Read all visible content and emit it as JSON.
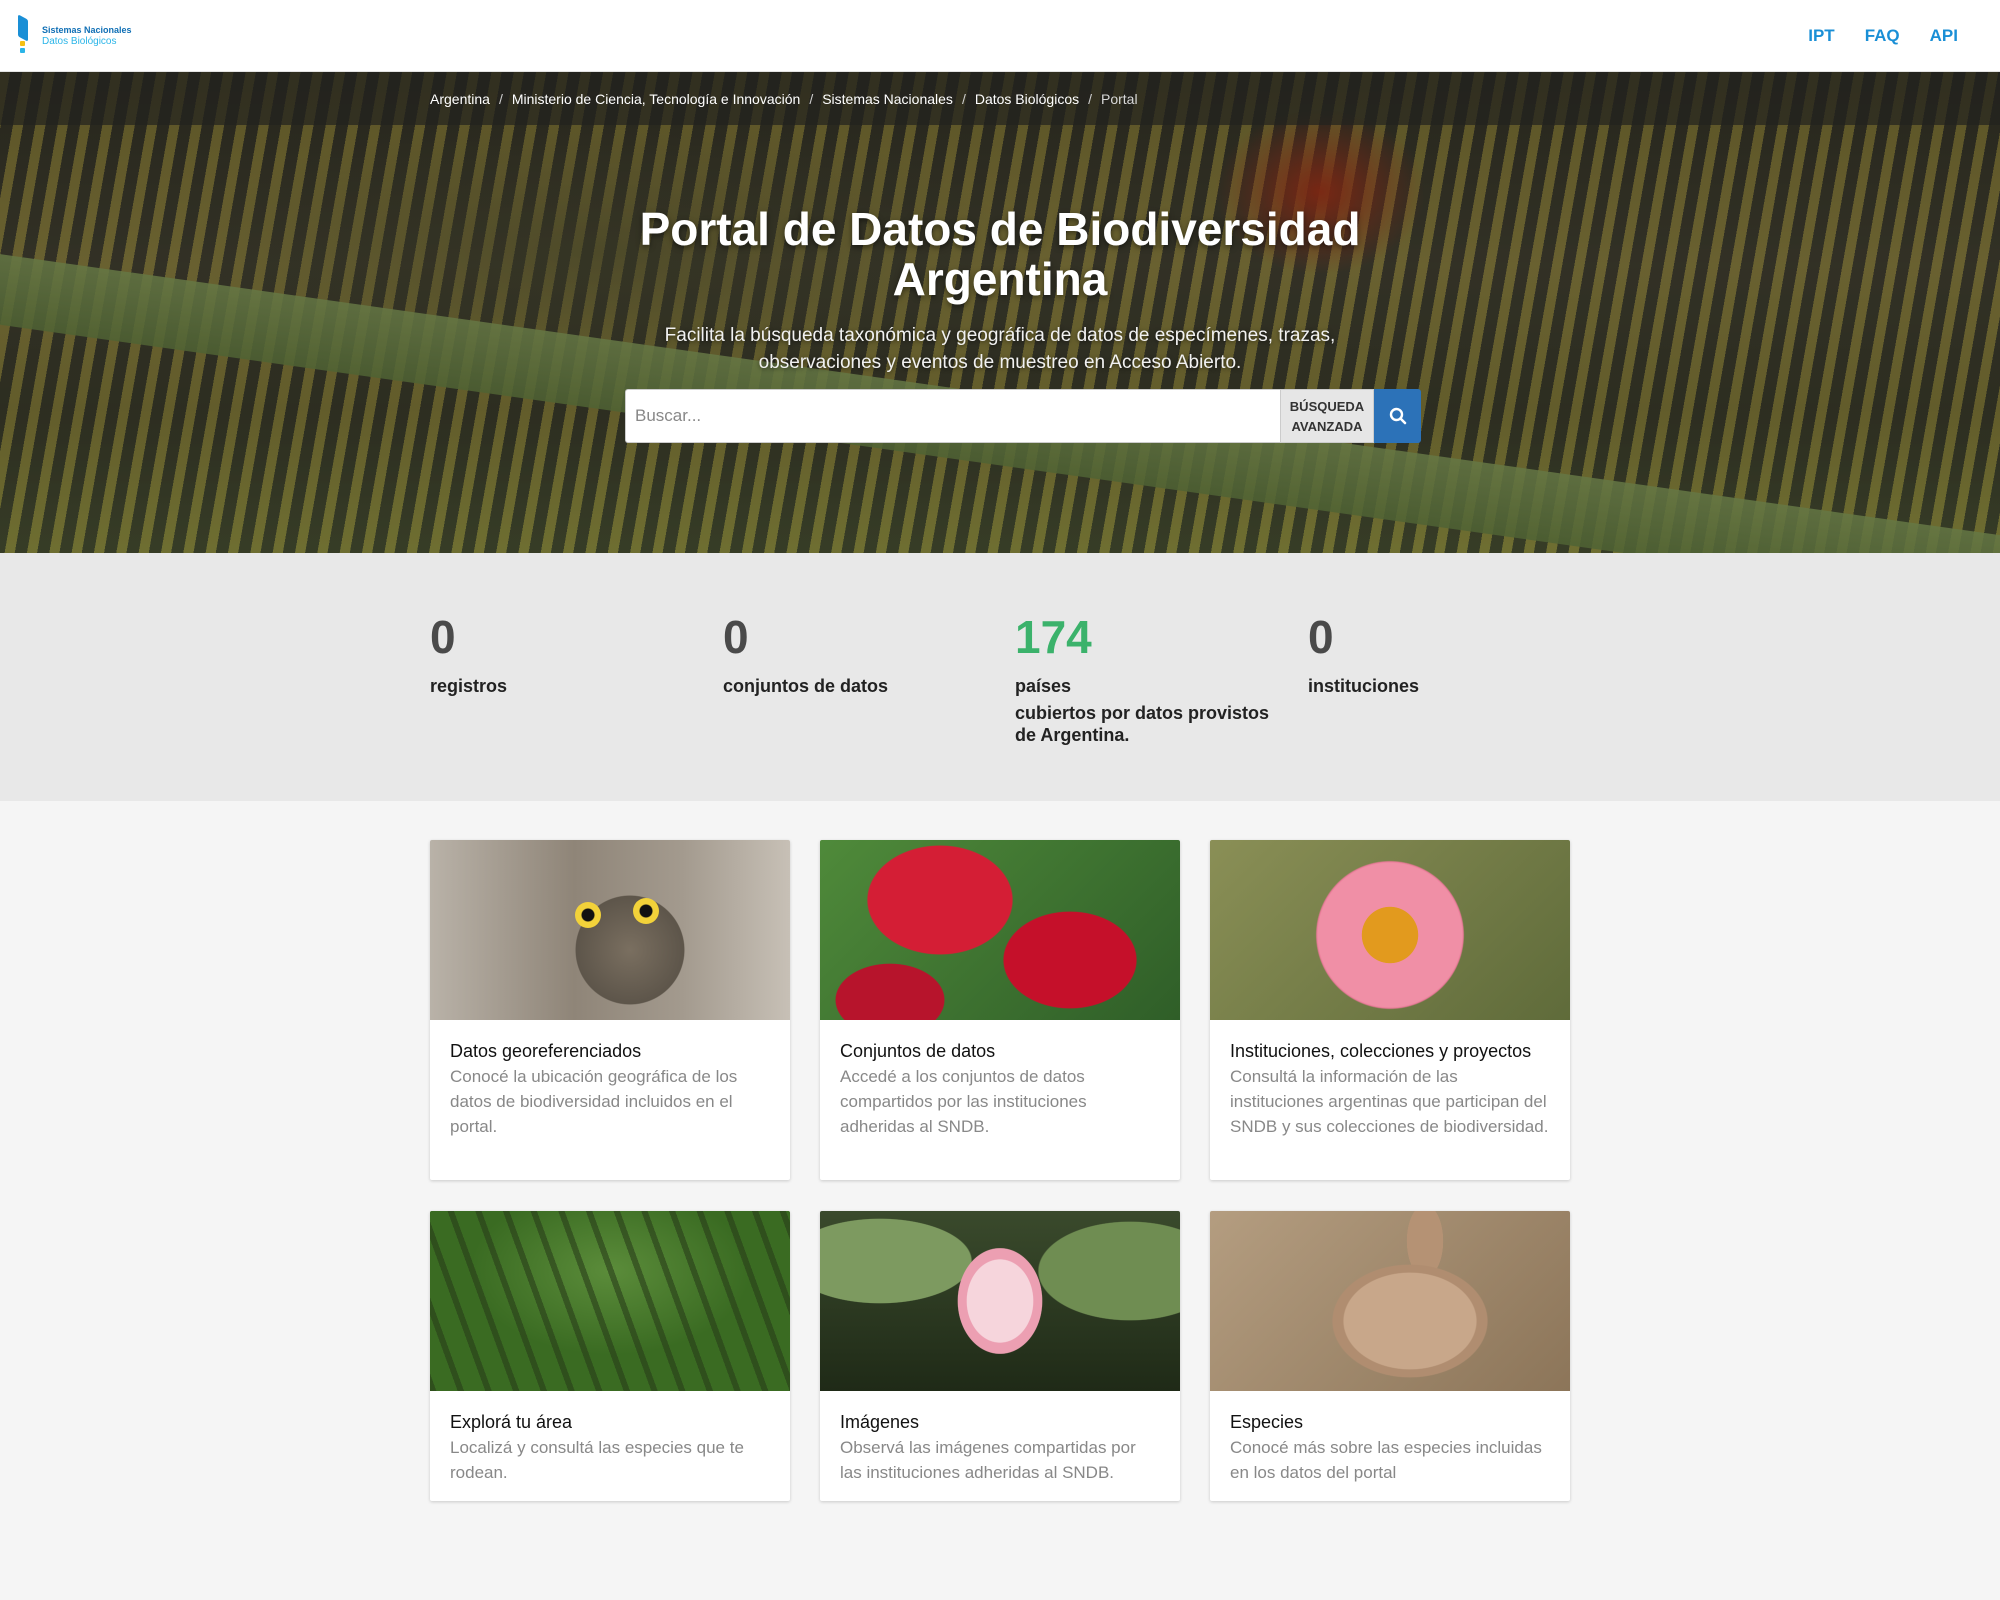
{
  "logo": {
    "line1": "Sistemas Nacionales",
    "line2": "Datos Biológicos"
  },
  "nav": {
    "links": [
      "IPT",
      "FAQ",
      "API"
    ]
  },
  "breadcrumb": {
    "items": [
      "Argentina",
      "Ministerio de Ciencia, Tecnología e Innovación",
      "Sistemas Nacionales",
      "Datos Biológicos"
    ],
    "current": "Portal",
    "separator": "/"
  },
  "hero": {
    "title_line1": "Portal de Datos de Biodiversidad",
    "title_line2": "Argentina",
    "subtitle_line1": "Facilita la búsqueda taxonómica y geográfica de datos de especímenes, trazas,",
    "subtitle_line2": "observaciones y eventos de muestreo en Acceso Abierto."
  },
  "search": {
    "placeholder": "Buscar...",
    "advanced_line1": "BÚSQUEDA",
    "advanced_line2": "AVANZADA",
    "icon": "search-icon"
  },
  "stats": [
    {
      "value": "0",
      "label": "registros"
    },
    {
      "value": "0",
      "label": "conjuntos de datos"
    },
    {
      "value": "174",
      "label": "países",
      "extra": "cubiertos por datos provistos de Argentina.",
      "accent": "#3bb26b"
    },
    {
      "value": "0",
      "label": "instituciones"
    }
  ],
  "cards": [
    {
      "title": "Datos georeferenciados",
      "desc": "Conocé la ubicación geográfica de los datos de biodiversidad incluidos en el portal."
    },
    {
      "title": "Conjuntos de datos",
      "desc": "Accedé a los conjuntos de datos compartidos por las instituciones adheridas al SNDB."
    },
    {
      "title": "Instituciones, colecciones y proyectos",
      "desc": "Consultá la información de las instituciones argentinas que participan del SNDB y sus colecciones de biodiversidad."
    },
    {
      "title": "Explorá tu área",
      "desc": "Localizá y consultá las especies que te rodean."
    },
    {
      "title": "Imágenes",
      "desc": "Observá las imágenes compartidas por las instituciones adheridas al SNDB."
    },
    {
      "title": "Especies",
      "desc": "Conocé más sobre las especies incluidas en los datos del portal"
    }
  ],
  "colors": {
    "brand_blue": "#1a8fd6",
    "search_button": "#2c72b8",
    "accent_green": "#3bb26b"
  }
}
